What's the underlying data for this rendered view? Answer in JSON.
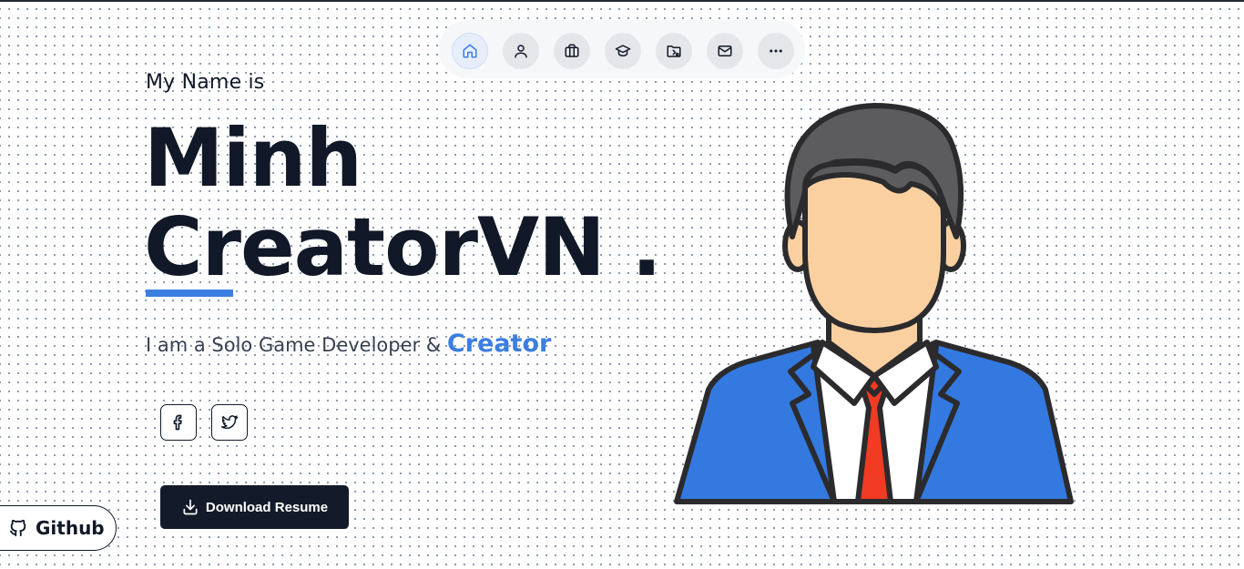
{
  "nav": {
    "items": [
      {
        "icon": "home-icon",
        "label": "Home",
        "active": true
      },
      {
        "icon": "user-icon",
        "label": "About"
      },
      {
        "icon": "briefcase-icon",
        "label": "Experience"
      },
      {
        "icon": "graduation-cap-icon",
        "label": "Education"
      },
      {
        "icon": "folder-icon",
        "label": "Projects"
      },
      {
        "icon": "mail-icon",
        "label": "Contact"
      },
      {
        "icon": "more-icon",
        "label": "More"
      }
    ]
  },
  "hero": {
    "intro": "My Name is",
    "name_line1": "Minh",
    "name_line2": "CreatorVN .",
    "tagline_prefix": "I am a Solo Game Developer & ",
    "tagline_accent": "Creator"
  },
  "social": {
    "facebook_icon": "facebook-icon",
    "twitter_icon": "twitter-icon"
  },
  "actions": {
    "download_label": "Download Resume",
    "github_label": "Github"
  },
  "colors": {
    "accent": "#3b7ee2",
    "dark": "#131a29",
    "suit": "#3379e0",
    "tie": "#f13b22",
    "skin": "#fbd0a0",
    "hair": "#5c5c5e"
  }
}
